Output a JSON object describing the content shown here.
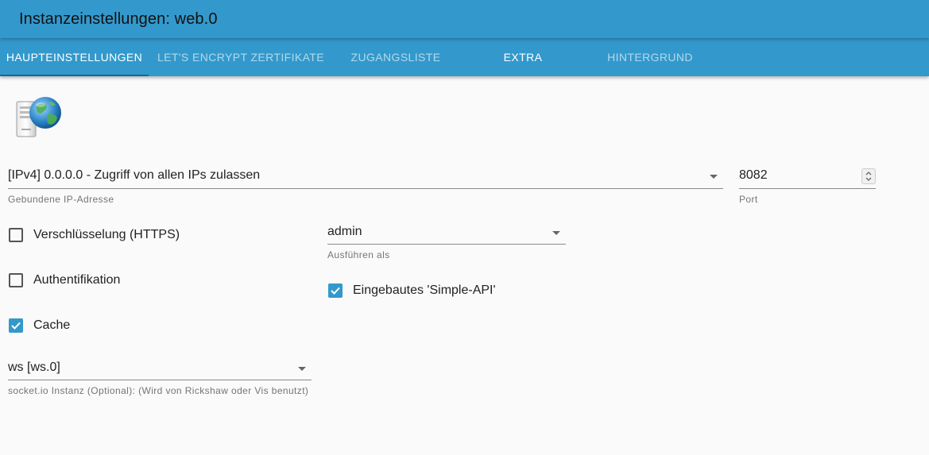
{
  "header": {
    "title": "Instanzeinstellungen: web.0"
  },
  "tabs": [
    {
      "label": "HAUPTEINSTELLUNGEN",
      "active": true
    },
    {
      "label": "LET'S ENCRYPT ZERTIFIKATE",
      "active": false
    },
    {
      "label": "ZUGANGSLISTE",
      "active": false
    },
    {
      "label": "EXTRA",
      "active": false
    },
    {
      "label": "HINTERGRUND",
      "active": false
    }
  ],
  "logo": {
    "icon": "web-server-globe-icon"
  },
  "ip": {
    "value": "[IPv4] 0.0.0.0 - Zugriff von allen IPs zulassen",
    "helper": "Gebundene IP-Adresse"
  },
  "port": {
    "value": "8082",
    "helper": "Port"
  },
  "checkboxes": {
    "https": {
      "label": "Verschlüsselung (HTTPS)",
      "checked": false
    },
    "auth": {
      "label": "Authentifikation",
      "checked": false
    },
    "cache": {
      "label": "Cache",
      "checked": true
    },
    "simple_api": {
      "label": "Eingebautes 'Simple-API'",
      "checked": true
    }
  },
  "run_as": {
    "value": "admin",
    "helper": "Ausführen als"
  },
  "socketio": {
    "value": "ws [ws.0]",
    "helper": "socket.io Instanz (Optional): (Wird von Rickshaw oder Vis benutzt)"
  },
  "colors": {
    "primary": "#3399cc",
    "indicator": "#1565a8",
    "background": "#fafafa"
  }
}
